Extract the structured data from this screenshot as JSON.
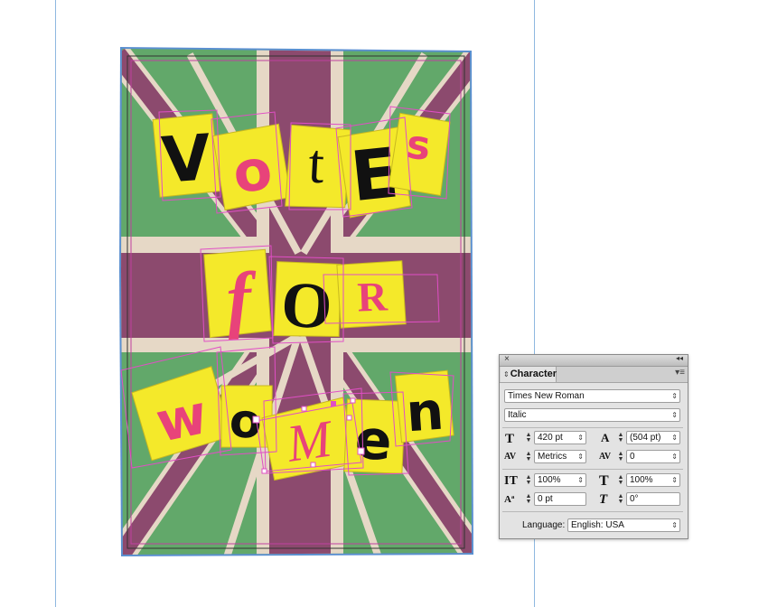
{
  "poster": {
    "letters": [
      "V",
      "o",
      "t",
      "E",
      "s",
      "f",
      "O",
      "R",
      "w",
      "o",
      "M",
      "e",
      "n"
    ],
    "colors": {
      "green": "#62a86a",
      "purple": "#8c4a6e",
      "beige": "#e6d8c6",
      "yellow": "#f4e92a",
      "pink": "#e8437a",
      "black": "#111111",
      "frame_selection": "#e04fc5",
      "bleed_blue": "#5a8fd0",
      "guide": "#8fb8e0"
    }
  },
  "character_panel": {
    "close_glyph": "×",
    "collapse_glyph": "◂◂",
    "tab_arrows": "⇕",
    "tab_title": "Character",
    "menu_glyph": "▾≡",
    "font_family": "Times New Roman",
    "font_style": "Italic",
    "font_size": "420 pt",
    "leading": "(504 pt)",
    "kerning": "Metrics",
    "tracking": "0",
    "vertical_scale": "100%",
    "horizontal_scale": "100%",
    "baseline_shift": "0 pt",
    "skew": "0°",
    "language_label": "Language:",
    "language_value": "English: USA",
    "spinner_up": "▲",
    "spinner_down": "▼",
    "dropdown_glyph": "⇕",
    "icons": {
      "size": "T",
      "leading": "A",
      "kerning": "AV",
      "tracking": "AV",
      "vscale": "IT",
      "hscale": "T",
      "baseline": "Aª",
      "skew": "T"
    }
  }
}
